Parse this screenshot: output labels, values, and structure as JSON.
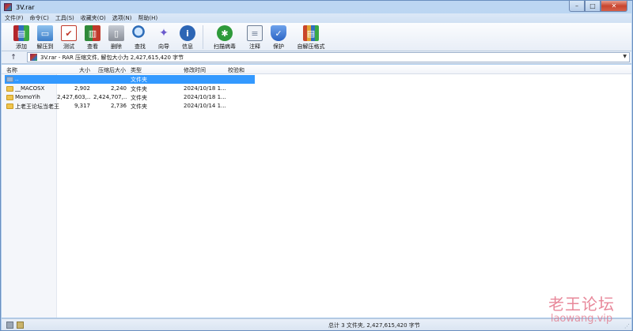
{
  "window": {
    "title": "3V.rar",
    "controls": {
      "minimize": "–",
      "maximize": "□",
      "close": "✕"
    }
  },
  "menu": [
    "文件(F)",
    "命令(C)",
    "工具(S)",
    "收藏夹(O)",
    "选项(N)",
    "帮助(H)"
  ],
  "toolbar": {
    "buttons": [
      {
        "label": "添加",
        "icon": "books-add-icon",
        "color": "#b3262b"
      },
      {
        "label": "解压到",
        "icon": "folder-extract-icon",
        "color": "#3d7ec9"
      },
      {
        "label": "测试",
        "icon": "test-checklist-icon",
        "color": "#c0392b"
      },
      {
        "label": "查看",
        "icon": "view-book-icon",
        "color": "#2f8a3a"
      },
      {
        "label": "删除",
        "icon": "trash-icon",
        "color": "#8a8f98"
      },
      {
        "label": "查找",
        "icon": "magnifier-icon",
        "color": "#2e6db8"
      },
      {
        "label": "向导",
        "icon": "wand-icon",
        "color": "#6a5acd"
      },
      {
        "label": "信息",
        "icon": "info-icon",
        "color": "#2d66b5"
      },
      {
        "label": "扫描病毒",
        "icon": "virus-scan-icon",
        "color": "#2e9a3a"
      },
      {
        "label": "注释",
        "icon": "comment-icon",
        "color": "#6f7f96"
      },
      {
        "label": "保护",
        "icon": "shield-icon",
        "color": "#2a63c4"
      },
      {
        "label": "自解压格式",
        "icon": "sfx-books-icon",
        "color": "#c9452a"
      }
    ]
  },
  "address": {
    "up": "↑",
    "path": "3V.rar - RAR 压缩文件, 解包大小为 2,427,615,420 字节",
    "dropdown": "▼"
  },
  "columns": [
    "名称",
    "大小",
    "压缩后大小",
    "类型",
    "修改时间",
    "校验和"
  ],
  "rows": [
    {
      "name": "..",
      "size": "",
      "packed": "",
      "type": "文件夹",
      "modified": "",
      "crc": "",
      "selected": true,
      "up": true
    },
    {
      "name": "__MACOSX",
      "size": "2,902",
      "packed": "2,240",
      "type": "文件夹",
      "modified": "2024/10/18 1...",
      "crc": ""
    },
    {
      "name": "MomoYih",
      "size": "2,427,603,...",
      "packed": "2,424,707,...",
      "type": "文件夹",
      "modified": "2024/10/18 1...",
      "crc": ""
    },
    {
      "name": "上老王论坛当老王",
      "size": "9,317",
      "packed": "2,736",
      "type": "文件夹",
      "modified": "2024/10/14 1...",
      "crc": ""
    }
  ],
  "status": {
    "text": "总计 3 文件夹, 2,427,615,420 字节"
  },
  "watermark": {
    "line1": "老王论坛",
    "line2": "laowang.vip"
  }
}
